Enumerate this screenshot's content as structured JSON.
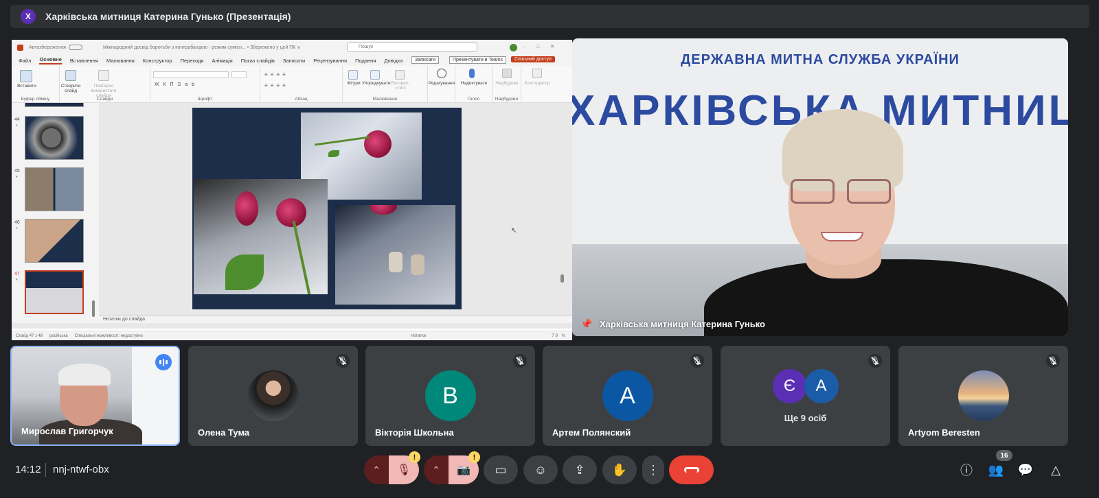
{
  "meeting": {
    "presenter_initial": "Х",
    "title": "Харківська митниця Катерина Гунько (Презентація)",
    "time": "14:12",
    "code": "nnj-ntwf-obx",
    "participant_count": "16"
  },
  "powerpoint": {
    "autosave": "Автозбереження",
    "doc_title": "Міжнародний досвід боротьби з контрабандою - режим сумісн... • Збережено у цей ПК ∨",
    "search_placeholder": "Пошук",
    "menu": [
      "Файл",
      "Основне",
      "Вставлення",
      "Малювання",
      "Конструктор",
      "Переходи",
      "Анімація",
      "Показ слайдів",
      "Записати",
      "Рецензування",
      "Подання",
      "Довідка"
    ],
    "active_menu": "Основне",
    "record_btn": "Записати",
    "teams_btn": "Презентувати в Teams",
    "share_btn": "Спільний доступ",
    "ribbon_groups": [
      "Буфер обміну",
      "Слайди",
      "Шрифт",
      "Абзац",
      "Малювання",
      "Голос",
      "Надбудови"
    ],
    "ribbon_buttons": {
      "paste": "Вставити",
      "new_slide": "Створити слайд",
      "reuse": "Повторно використати слайди",
      "shapes": "Фігури",
      "arrange": "Упорядкувати",
      "quick_styles": "Експрес-стилі",
      "editing": "Редагування",
      "dictate": "Надиктувати",
      "addins": "Надбудови",
      "designer": "Конструктор"
    },
    "thumbs": [
      {
        "num": "44",
        "star": "*"
      },
      {
        "num": "45",
        "star": "*"
      },
      {
        "num": "46",
        "star": "*"
      },
      {
        "num": "47",
        "star": "*"
      }
    ],
    "notes_placeholder": "Нотатки до слайда",
    "status_left": "Слайд 47 з 48",
    "status_lang": "російська",
    "status_access": "Спеціальні можливості: недоступно",
    "status_notes": "Нотатки",
    "zoom": "79 %"
  },
  "speaker": {
    "banner_top": "ДЕРЖАВНА МИТНА СЛУЖБА УКРАЇНИ",
    "banner_main": "ХАРКІВСЬКА МИТНИЦ",
    "name": "Харківська митниця Катерина Гунько"
  },
  "tiles": [
    {
      "name": "Мирослав Григорчук"
    },
    {
      "name": "Олена Тума"
    },
    {
      "name": "Вікторія Школьна",
      "initial": "В",
      "color": "#00897b"
    },
    {
      "name": "Артем Полянский",
      "initial": "А",
      "color": "#0b57a4"
    },
    {
      "name": "Ще 9 осіб",
      "initials": [
        "Є",
        "А"
      ],
      "colors": [
        "#5b2fb4",
        "#1a5ca8"
      ]
    },
    {
      "name": "Artyom Beresten"
    }
  ],
  "controls": {
    "warn_symbol": "!"
  },
  "colors": {
    "background": "#202124",
    "tile": "#3c4043",
    "hangup": "#ea4335",
    "muted_bg": "#f2b8b5",
    "accent": "#8ab4f8"
  }
}
